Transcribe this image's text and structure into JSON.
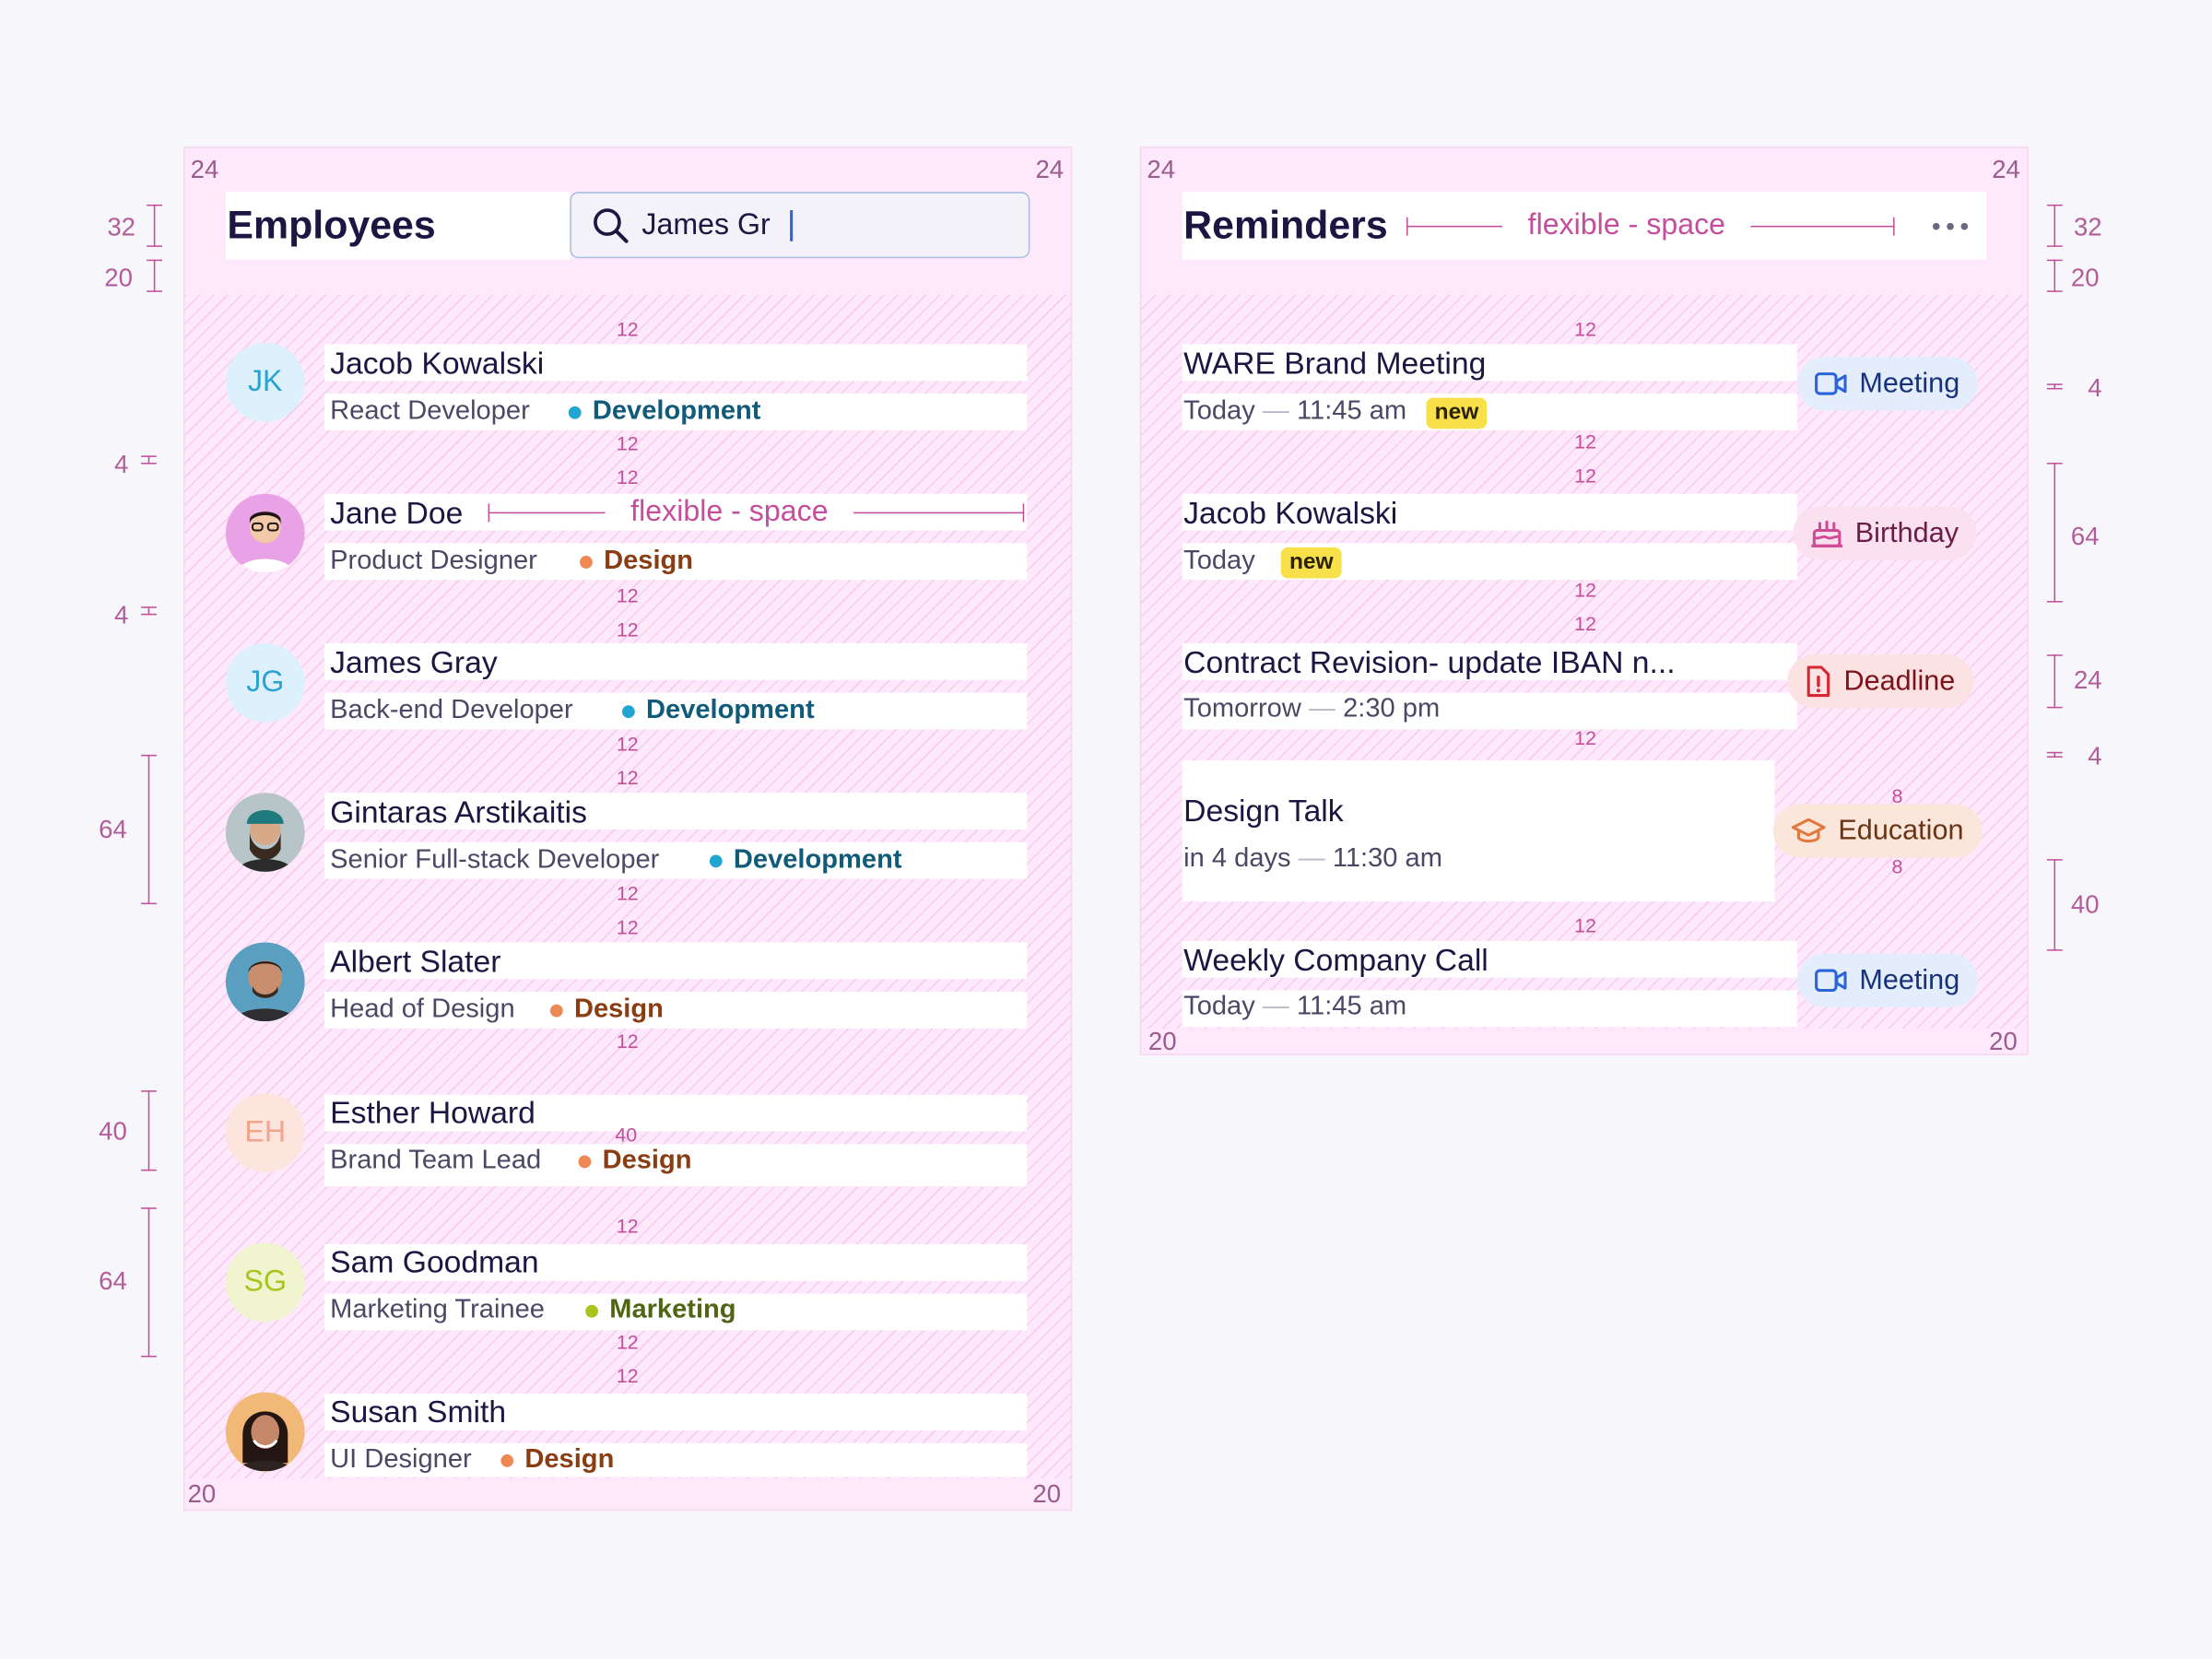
{
  "employees": {
    "title": "Employees",
    "search_value": "James Gr",
    "list": [
      {
        "name": "Jacob Kowalski",
        "role": "React Developer",
        "dept": "Development",
        "avatar_type": "initials",
        "initials": "JK"
      },
      {
        "name": "Jane Doe",
        "role": "Product Designer",
        "dept": "Design",
        "avatar_type": "photo",
        "photo": "person-with-glasses"
      },
      {
        "name": "James Gray",
        "role": "Back-end Developer",
        "dept": "Development",
        "avatar_type": "initials",
        "initials": "JG"
      },
      {
        "name": "Gintaras Arstikaitis",
        "role": "Senior Full-stack Developer",
        "dept": "Development",
        "avatar_type": "photo",
        "photo": "bearded-man-with-beanie"
      },
      {
        "name": "Albert Slater",
        "role": "Head of Design",
        "dept": "Design",
        "avatar_type": "photo",
        "photo": "smiling-man"
      },
      {
        "name": "Esther Howard",
        "role": "Brand Team Lead",
        "dept": "Design",
        "avatar_type": "initials",
        "initials": "EH"
      },
      {
        "name": "Sam Goodman",
        "role": "Marketing Trainee",
        "dept": "Marketing",
        "avatar_type": "initials",
        "initials": "SG"
      },
      {
        "name": "Susan Smith",
        "role": "UI Designer",
        "dept": "Design",
        "avatar_type": "photo",
        "photo": "woman-dark-hair"
      }
    ]
  },
  "reminders": {
    "title": "Reminders",
    "more_icon": "more-horizontal-icon",
    "items": [
      {
        "title": "WARE Brand Meeting",
        "when": "Today",
        "time": "11:45 am",
        "new_label": "new",
        "chip": "Meeting",
        "chip_icon": "video-camera-icon"
      },
      {
        "title": "Jacob Kowalski",
        "when": "Today",
        "time": "",
        "new_label": "new",
        "chip": "Birthday",
        "chip_icon": "cake-icon"
      },
      {
        "title": "Contract Revision- update IBAN n...",
        "when": "Tomorrow",
        "time": "2:30 pm",
        "new_label": "",
        "chip": "Deadline",
        "chip_icon": "document-alert-icon"
      },
      {
        "title": "Design Talk",
        "when": "in 4 days",
        "time": "11:30 am",
        "new_label": "",
        "chip": "Education",
        "chip_icon": "graduation-cap-icon"
      },
      {
        "title": "Weekly Company  Call",
        "when": "Today",
        "time": "11:45 am",
        "new_label": "",
        "chip": "Meeting",
        "chip_icon": "video-camera-icon"
      }
    ]
  },
  "annotations": {
    "pad_24": "24",
    "pad_20": "20",
    "gap_12": "12",
    "gap_8": "8",
    "gap_40": "40",
    "dim_32": "32",
    "dim_20": "20",
    "dim_4": "4",
    "dim_64": "64",
    "dim_40": "40",
    "dim_24": "24",
    "flex_label": "flexible - space"
  },
  "colors": {
    "development": "#21a5d3",
    "design": "#ee8854",
    "marketing": "#a7c41c",
    "annotation": "#c54e9c",
    "new_badge": "#f8e04a"
  }
}
